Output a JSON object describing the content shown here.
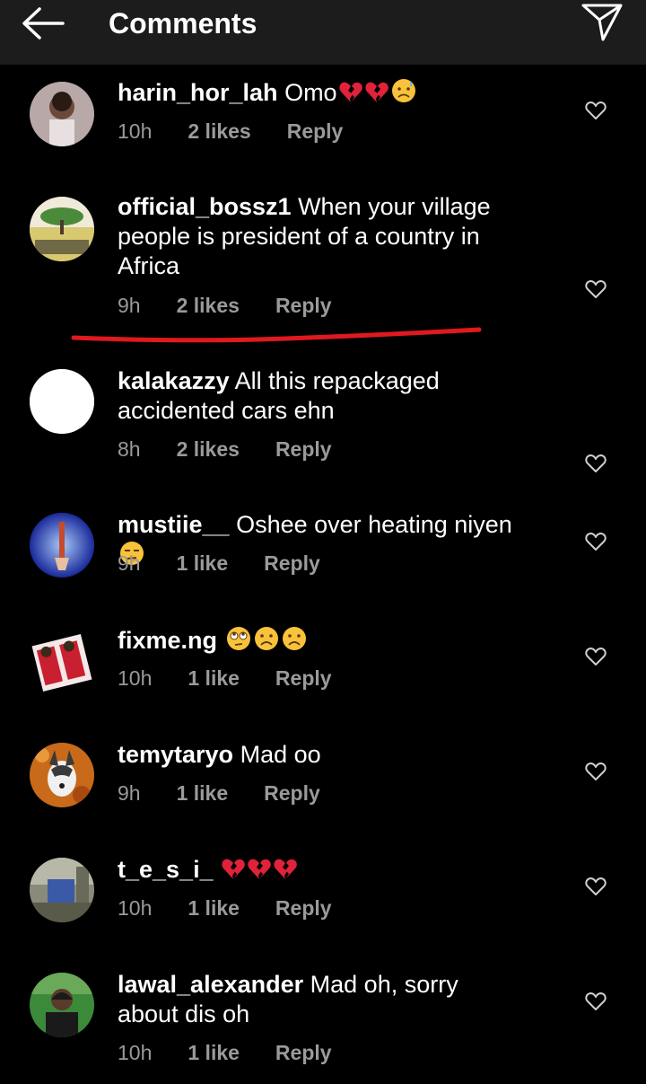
{
  "header": {
    "title": "Comments",
    "back_icon": "arrow-left-icon",
    "send_icon": "paper-plane-icon"
  },
  "colors": {
    "background": "#000000",
    "header_bg": "#1c1c1c",
    "meta_text": "#9a9a9a",
    "annotation_line": "#e0191e"
  },
  "comments": [
    {
      "username": "harin_hor_lah",
      "text": "Omo",
      "emoji": [
        "broken-heart",
        "broken-heart",
        "sad-sweat-face"
      ],
      "time": "10h",
      "likes": "2 likes",
      "reply": "Reply"
    },
    {
      "username": "official_bossz1",
      "text": "When your village people is president of a country in Africa",
      "emoji": [],
      "time": "9h",
      "likes": "2 likes",
      "reply": "Reply"
    },
    {
      "username": "kalakazzy",
      "text": "All this repackaged accidented cars ehn",
      "emoji": [],
      "time": "8h",
      "likes": "2 likes",
      "reply": "Reply"
    },
    {
      "username": "mustiie__",
      "text": "Oshee over heating niyen",
      "emoji": [
        "unamused-face"
      ],
      "time": "9h",
      "likes": "1 like",
      "reply": "Reply"
    },
    {
      "username": "fixme.ng",
      "text": "",
      "emoji": [
        "eye-roll-face",
        "frowning-face",
        "frowning-face"
      ],
      "time": "10h",
      "likes": "1 like",
      "reply": "Reply"
    },
    {
      "username": "temytaryo",
      "text": "Mad oo",
      "emoji": [],
      "time": "9h",
      "likes": "1 like",
      "reply": "Reply"
    },
    {
      "username": "t_e_s_i_",
      "text": "",
      "emoji": [
        "broken-heart",
        "broken-heart",
        "broken-heart"
      ],
      "time": "10h",
      "likes": "1 like",
      "reply": "Reply"
    },
    {
      "username": "lawal_alexander",
      "text": "Mad oh, sorry about dis oh",
      "emoji": [],
      "time": "10h",
      "likes": "1 like",
      "reply": "Reply"
    }
  ]
}
